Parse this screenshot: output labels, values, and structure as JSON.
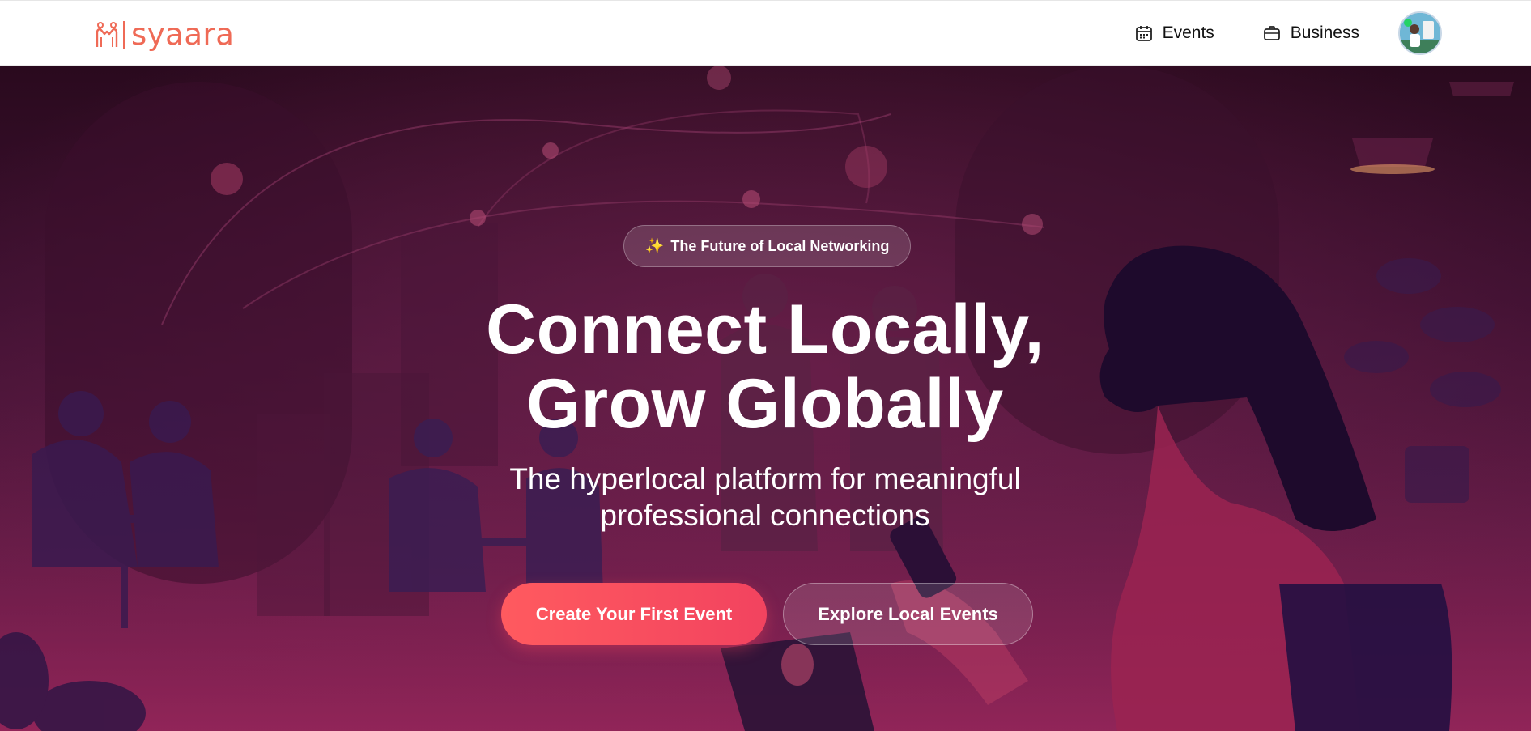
{
  "brand": {
    "name": "syaara",
    "color": "#ef6a56"
  },
  "nav": {
    "events_label": "Events",
    "business_label": "Business",
    "events_icon": "calendar-icon",
    "business_icon": "briefcase-icon"
  },
  "hero": {
    "tagline": "The Future of Local Networking",
    "tagline_icon": "sparkles-icon",
    "headline_line1": "Connect Locally,",
    "headline_line2": "Grow Globally",
    "subheadline_line1": "The hyperlocal platform for meaningful",
    "subheadline_line2": "professional connections",
    "primary_cta": "Create Your First Event",
    "secondary_cta": "Explore Local Events"
  },
  "colors": {
    "accent": "#ff5a5f",
    "hero_dark": "#2a0a1e",
    "hero_mid": "#5c1a43"
  }
}
